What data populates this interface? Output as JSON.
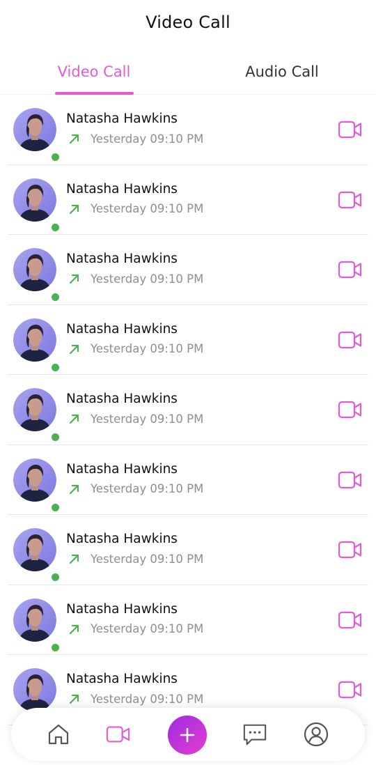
{
  "header": {
    "title": "Video Call"
  },
  "tabs": [
    {
      "label": "Video Call",
      "active": true
    },
    {
      "label": "Audio Call",
      "active": false
    }
  ],
  "colors": {
    "accent": "#e35ad6",
    "online": "#4caf50",
    "outgoing_arrow": "#4caf50",
    "fab_gradient": [
      "#9b2be0",
      "#e43dd2"
    ]
  },
  "calls": [
    {
      "name": "Natasha Hawkins",
      "time": "Yesterday 09:10 PM",
      "direction": "outgoing",
      "online": true
    },
    {
      "name": "Natasha Hawkins",
      "time": "Yesterday 09:10 PM",
      "direction": "outgoing",
      "online": true
    },
    {
      "name": "Natasha Hawkins",
      "time": "Yesterday 09:10 PM",
      "direction": "outgoing",
      "online": true
    },
    {
      "name": "Natasha Hawkins",
      "time": "Yesterday 09:10 PM",
      "direction": "outgoing",
      "online": true
    },
    {
      "name": "Natasha Hawkins",
      "time": "Yesterday 09:10 PM",
      "direction": "outgoing",
      "online": true
    },
    {
      "name": "Natasha Hawkins",
      "time": "Yesterday 09:10 PM",
      "direction": "outgoing",
      "online": true
    },
    {
      "name": "Natasha Hawkins",
      "time": "Yesterday 09:10 PM",
      "direction": "outgoing",
      "online": true
    },
    {
      "name": "Natasha Hawkins",
      "time": "Yesterday 09:10 PM",
      "direction": "outgoing",
      "online": true
    },
    {
      "name": "Natasha Hawkins",
      "time": "Yesterday 09:10 PM",
      "direction": "outgoing",
      "online": true
    }
  ],
  "bottom_nav": {
    "items": [
      {
        "icon": "home-icon",
        "active": false
      },
      {
        "icon": "video-camera-icon",
        "active": true
      },
      {
        "icon": "plus-icon",
        "active": false
      },
      {
        "icon": "chat-icon",
        "active": false
      },
      {
        "icon": "profile-icon",
        "active": false
      }
    ]
  }
}
